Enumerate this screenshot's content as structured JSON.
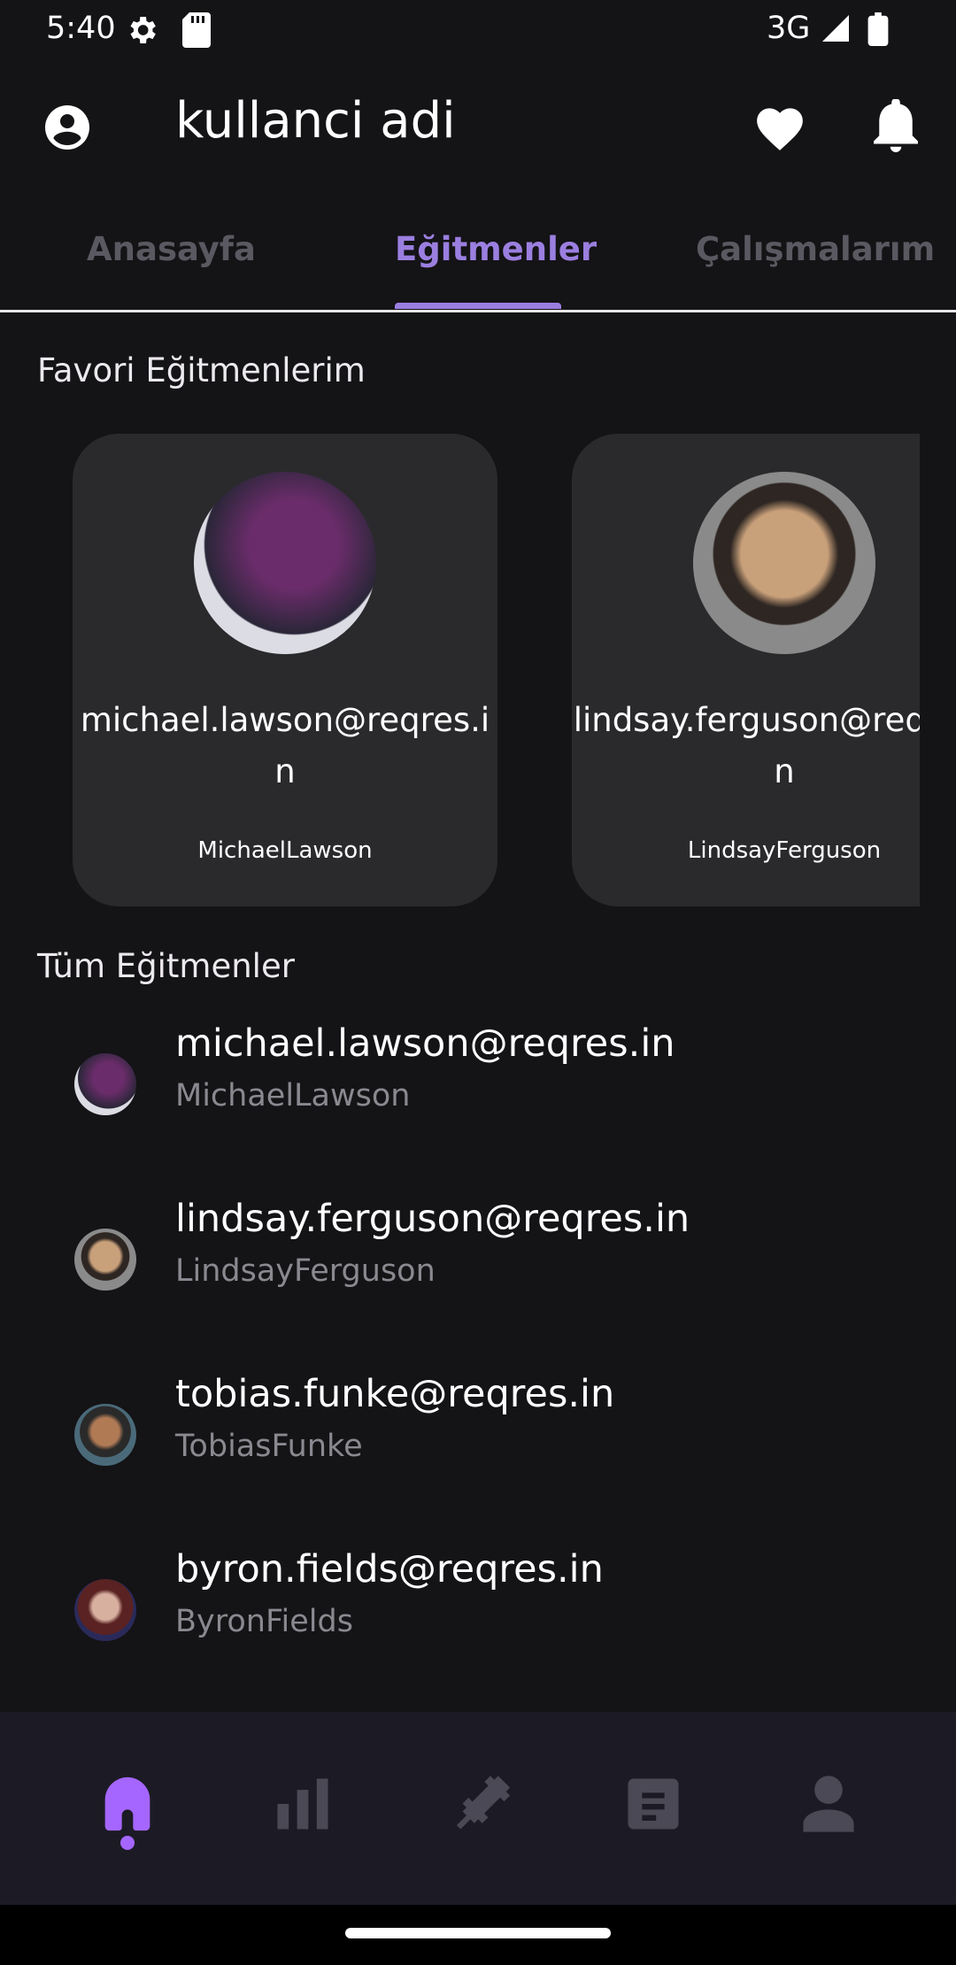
{
  "status_bar": {
    "time": "5:40",
    "network": "3G"
  },
  "app_bar": {
    "title": "kullanci adi"
  },
  "tabs": [
    {
      "label": "Anasayfa",
      "selected": false
    },
    {
      "label": "Eğitmenler",
      "selected": true
    },
    {
      "label": "Çalışmalarım",
      "selected": false
    }
  ],
  "favorites": {
    "title": "Favori Eğitmenlerim",
    "items": [
      {
        "email": "michael.lawson@reqres.in",
        "username": "MichaelLawson"
      },
      {
        "email": "lindsay.ferguson@reqres.in",
        "username": "LindsayFerguson"
      }
    ]
  },
  "all": {
    "title": "Tüm Eğitmenler",
    "items": [
      {
        "email": "michael.lawson@reqres.in",
        "username": "MichaelLawson"
      },
      {
        "email": "lindsay.ferguson@reqres.in",
        "username": "LindsayFerguson"
      },
      {
        "email": "tobias.funke@reqres.in",
        "username": "TobiasFunke"
      },
      {
        "email": "byron.fields@reqres.in",
        "username": "ByronFields"
      }
    ]
  },
  "bottom_nav": {
    "items": [
      "home-icon",
      "bar-chart-icon",
      "dumbbell-icon",
      "document-icon",
      "person-icon"
    ],
    "active_index": 0
  },
  "colors": {
    "accent": "#9b7fe0",
    "nav_active": "#a566ff",
    "background": "#141316",
    "card": "#2a2a2d"
  }
}
